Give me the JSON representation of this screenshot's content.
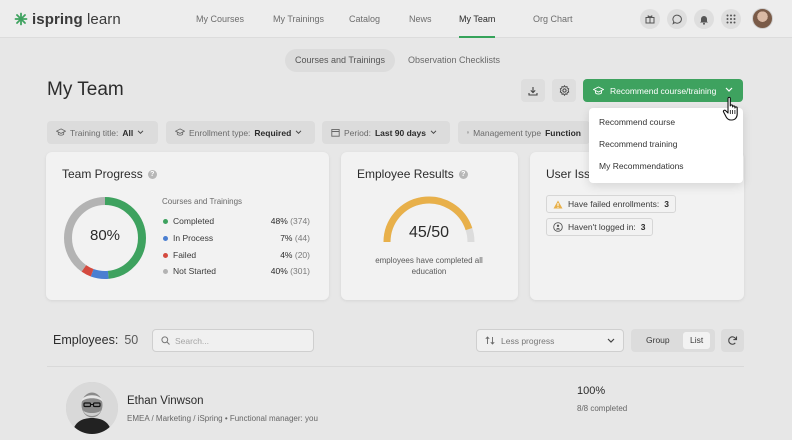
{
  "logo": {
    "bold": "ispring",
    "light": " learn"
  },
  "nav": [
    {
      "label": "My Courses",
      "active": false
    },
    {
      "label": "My Trainings",
      "active": false
    },
    {
      "label": "Catalog",
      "active": false
    },
    {
      "label": "News",
      "active": false
    },
    {
      "label": "My Team",
      "active": true
    },
    {
      "label": "Org Chart",
      "active": false
    }
  ],
  "subtabs": [
    {
      "label": "Courses and Trainings",
      "active": true
    },
    {
      "label": "Observation Checklists",
      "active": false
    }
  ],
  "page_title": "My Team",
  "recommend_button": "Recommend course/training",
  "dropdown": [
    "Recommend course",
    "Recommend training",
    "My Recommendations"
  ],
  "filters": [
    {
      "label": "Training title:",
      "value": "All"
    },
    {
      "label": "Enrollment type:",
      "value": "Required"
    },
    {
      "label": "Period:",
      "value": "Last 90 days"
    },
    {
      "label": "Management type",
      "value": "Function"
    }
  ],
  "team_progress": {
    "title": "Team Progress",
    "center_label": "80%",
    "legend_title": "Courses and Trainings",
    "rows": [
      {
        "label": "Completed",
        "pct": "48%",
        "count": "(374)",
        "color": "#3ea25f"
      },
      {
        "label": "In Process",
        "pct": "7%",
        "count": "(44)",
        "color": "#4a7fd1"
      },
      {
        "label": "Failed",
        "pct": "4%",
        "count": "(20)",
        "color": "#d44a3f"
      },
      {
        "label": "Not Started",
        "pct": "40%",
        "count": "(301)",
        "color": "#b3b3b3"
      }
    ]
  },
  "employee_results": {
    "title": "Employee Results",
    "value": "45/50",
    "fraction": 0.9,
    "subtitle": "employees have completed all education",
    "gauge_color": "#e8b04a"
  },
  "user_issues": {
    "title": "User Iss",
    "items": [
      {
        "label": "Have failed enrollments:",
        "count": "3",
        "icon": "warning-icon"
      },
      {
        "label": "Haven't logged in:",
        "count": "3",
        "icon": "logged-out-icon"
      }
    ]
  },
  "employees": {
    "label": "Employees:",
    "count": "50",
    "search_placeholder": "Search...",
    "sort_value": "Less progress",
    "view_group": "Group",
    "view_list": "List",
    "rows": [
      {
        "name": "Ethan Vinwson",
        "meta": "EMEA / Marketing / iSpring  •  Functional manager: you",
        "progress": "100%",
        "completed": "8/8 completed"
      }
    ]
  },
  "colors": {
    "accent": "#3ea25f"
  }
}
